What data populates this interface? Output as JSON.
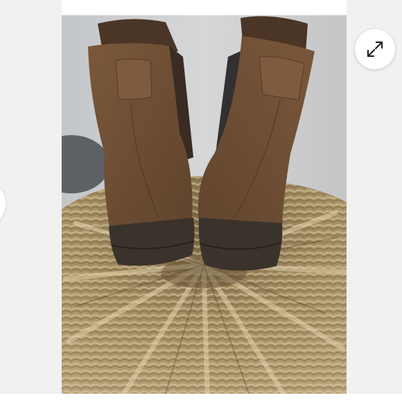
{
  "gallery": {
    "photo": {
      "subject": "boots-on-wicker-basket"
    },
    "expand_button": {
      "icon": "expand-arrows-icon"
    },
    "prev_button": {
      "icon": "prev-image-control"
    }
  },
  "colors": {
    "page_background": "#ffffff",
    "side_panel": "#f1f1f1",
    "suede": "#6e4d33",
    "sole": "#3b342d",
    "wicker": "#a08a5e",
    "backdrop": "#c9cacb"
  }
}
